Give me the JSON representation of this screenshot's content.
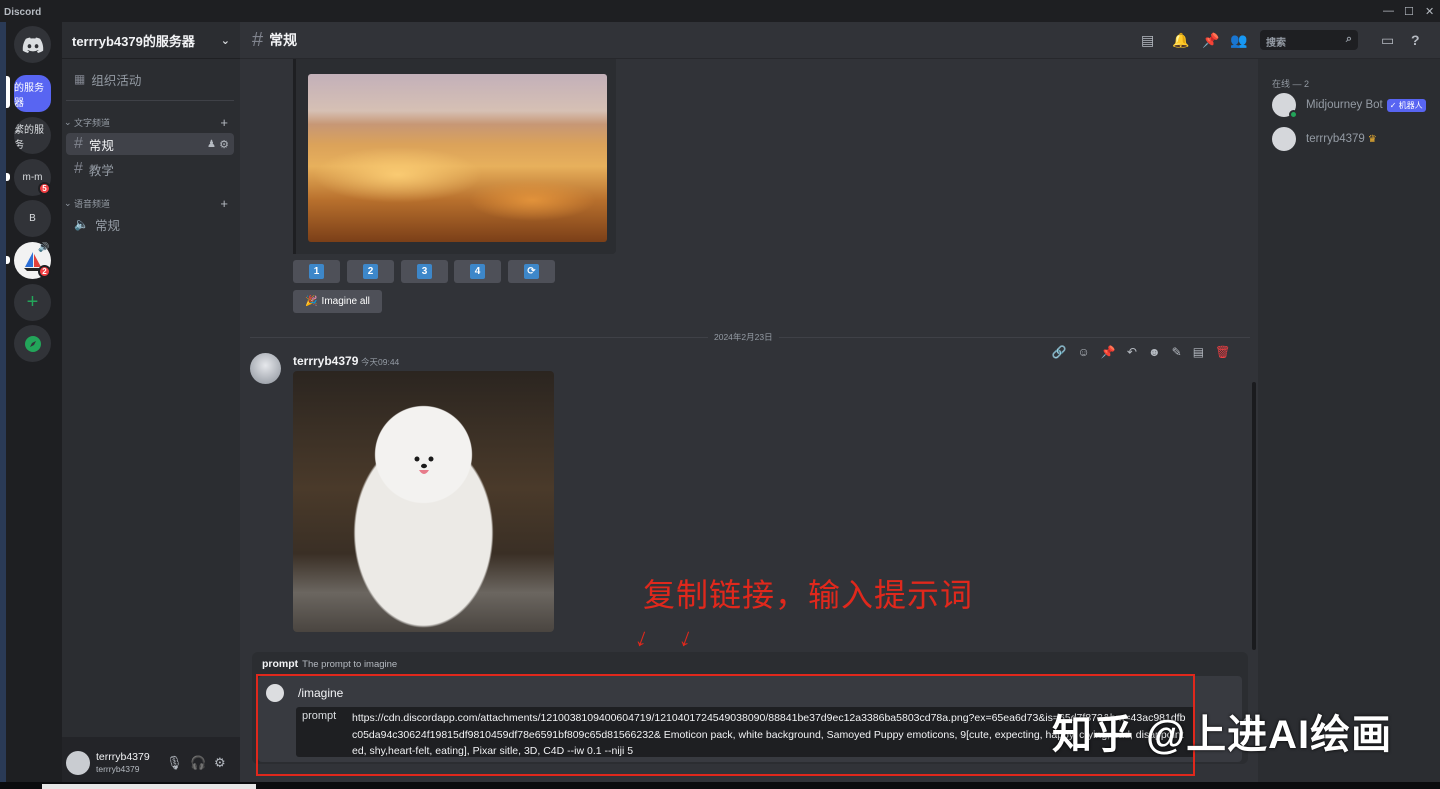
{
  "window": {
    "app_name": "Discord"
  },
  "servers": [
    {
      "label": ""
    },
    {
      "label": "的服务器"
    },
    {
      "label": "繁的服务"
    },
    {
      "label": "m-m",
      "badge": "5"
    },
    {
      "label": "B"
    },
    {
      "label": "",
      "badge": "2"
    }
  ],
  "guild": {
    "name": "terrryb4379的服务器"
  },
  "sidebar": {
    "events": "组织活动",
    "text_category": "文字频道",
    "text_channels": [
      "常规",
      "教学"
    ],
    "voice_category": "语音频道",
    "voice_channels": [
      "常规"
    ]
  },
  "user_panel": {
    "display_name": "terrryb4379",
    "username": "terrryb4379"
  },
  "header": {
    "channel": "常规",
    "search_placeholder": "搜索"
  },
  "upscale_buttons": [
    "1",
    "2",
    "3",
    "4"
  ],
  "imagine_all_label": "Imagine all",
  "date_divider": "2024年2月23日",
  "message": {
    "author": "terrryb4379",
    "time": "今天09:44"
  },
  "annotation": {
    "text": "复制链接，输入提示词"
  },
  "command": {
    "hint_name": "prompt",
    "hint_desc": "The prompt to imagine",
    "name": "/imagine",
    "option_key": "prompt",
    "option_value": "https://cdn.discordapp.com/attachments/1210038109400604719/1210401724549038090/88841be37d9ec12a3386ba5803cd78a.png?ex=65ea6d73&is=65d7f873&hm=43ac981dfbc05da94c30624f19815df9810459df78e6591bf809c65d81566232& Emoticon pack, white background, Samoyed Puppy emoticons, 9[cute, expecting, happy, crying, sad, disappointed, shy,heart-felt, eating], Pixar sitle, 3D, C4D --iw 0.1 --niji 5"
  },
  "members": {
    "category": "在线 — 2",
    "list": [
      {
        "name": "Midjourney Bot",
        "tag": "✓ 机器人"
      },
      {
        "name": "terrryb4379"
      }
    ]
  },
  "watermark": "知乎 @上进AI绘画",
  "colors": {
    "accent": "#5865f2",
    "annotation_red": "#e0281c",
    "online": "#23a55a"
  }
}
